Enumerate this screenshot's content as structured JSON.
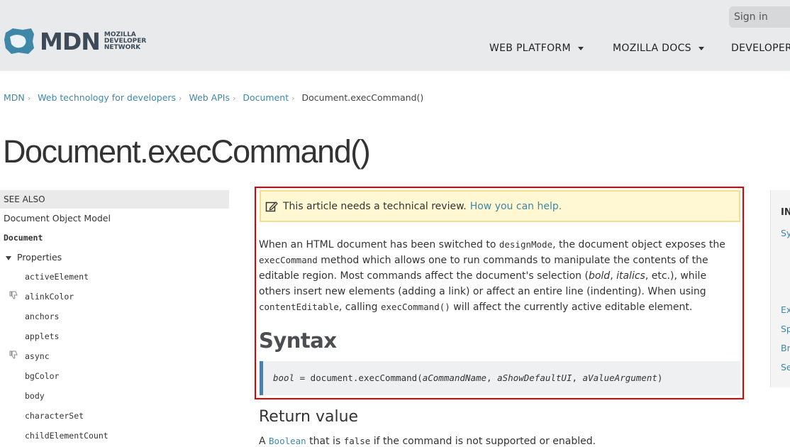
{
  "header": {
    "logo_text": "MDN",
    "logo_sub": [
      "MOZILLA",
      "DEVELOPER",
      "NETWORK"
    ],
    "signin": "Sign in",
    "nav": [
      "WEB PLATFORM",
      "MOZILLA DOCS",
      "DEVELOPER T"
    ]
  },
  "breadcrumb": {
    "items": [
      "MDN",
      "Web technology for developers",
      "Web APIs",
      "Document"
    ],
    "current": "Document.execCommand()"
  },
  "title": "Document.execCommand()",
  "sidebar": {
    "see_also": "SEE ALSO",
    "dom_link": "Document Object Model",
    "document_link": "Document",
    "properties_label": "Properties",
    "properties": [
      "activeElement",
      "alinkColor",
      "anchors",
      "applets",
      "async",
      "bgColor",
      "body",
      "characterSet",
      "childElementCount"
    ],
    "thumbs_down_on": [
      "alinkColor",
      "async"
    ]
  },
  "notice": {
    "text": "This article needs a technical review.",
    "link": "How you can help."
  },
  "intro": {
    "s1": "When an HTML document has been switched to ",
    "c1": "designMode",
    "s2": ", the document object exposes the ",
    "c2": "execCommand",
    "s3": " method which allows one to run commands to manipulate the contents of the editable region. Most commands affect the document's selection (",
    "e1": "bold",
    "s4": ", ",
    "e2": "italics",
    "s5": ", etc.), while others insert new elements (adding a link) or affect an entire line (indenting). When using ",
    "c3": "contentEditable",
    "s6": ", calling ",
    "c4": "execCommand()",
    "s7": " will affect the currently active editable element."
  },
  "syntax": {
    "heading": "Syntax",
    "ret": "bool",
    "eq": " = document.execCommand(",
    "arg1": "aCommandName",
    "sep1": ", ",
    "arg2": "aShowDefaultUI",
    "sep2": ", ",
    "arg3": "aValueArgument",
    "close": ")"
  },
  "return_value": {
    "heading": "Return value",
    "t1": "A ",
    "link": "Boolean",
    "t2": " that is ",
    "code": "false",
    "t3": " if the command is not supported or enabled."
  },
  "toc": {
    "head": "IN",
    "links": [
      "Sy",
      "Ex",
      "Sp",
      "Br",
      "Se"
    ]
  },
  "colors": {
    "link": "#3f87a6",
    "highlight_border": "#e00000",
    "notice_bg": "#fff8d3",
    "code_bar": "#4d7ead"
  }
}
